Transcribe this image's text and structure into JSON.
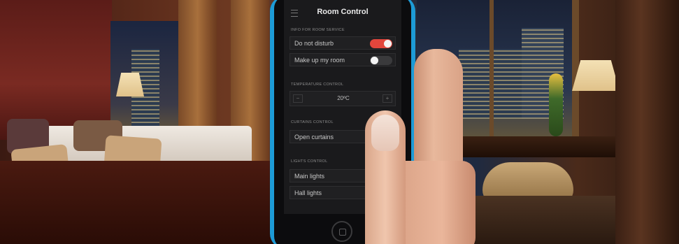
{
  "app": {
    "title": "Room Control"
  },
  "sections": {
    "service": {
      "label": "INFO FOR ROOM SERVICE",
      "items": [
        {
          "label": "Do not disturb",
          "state": "on"
        },
        {
          "label": "Make up my room",
          "state": "off"
        }
      ]
    },
    "temperature": {
      "label": "TEMPERATURE CONTROL",
      "value": "20ºC",
      "decrease_icon": "minus-icon",
      "increase_icon": "plus-icon"
    },
    "curtains": {
      "label": "CURTAINS CONTROL",
      "items": [
        {
          "label": "Open curtains"
        }
      ]
    },
    "lights": {
      "label": "LIGHTS CONTROL",
      "items": [
        {
          "label": "Main lights",
          "state": "off"
        },
        {
          "label": "Hall lights",
          "state": "off"
        }
      ]
    }
  },
  "colors": {
    "toggle_on": "#e2463c",
    "phone_case": "#1d9bd6",
    "screen_bg": "#1a1a1c"
  },
  "icons": {
    "menu": "menu-icon",
    "home": "home-button-icon"
  }
}
